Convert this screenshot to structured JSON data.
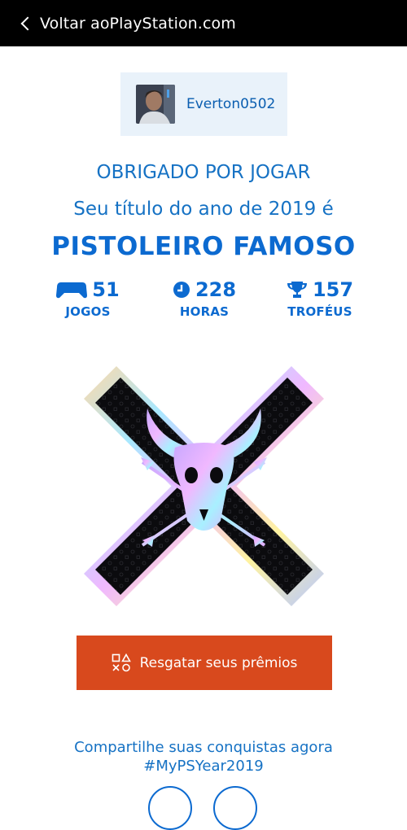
{
  "header": {
    "back_label": "Voltar aoPlayStation.com"
  },
  "user": {
    "username": "Everton0502"
  },
  "texts": {
    "thanks": "OBRIGADO POR JOGAR",
    "subtitle": "Seu título do ano de 2019 é",
    "award_title": "PISTOLEIRO FAMOSO"
  },
  "stats": [
    {
      "value": "51",
      "label": "JOGOS",
      "icon": "gamepad-icon"
    },
    {
      "value": "228",
      "label": "HORAS",
      "icon": "clock-icon"
    },
    {
      "value": "157",
      "label": "TROFÉUS",
      "icon": "trophy-icon"
    }
  ],
  "actions": {
    "redeem_label": "Resgatar seus prêmios"
  },
  "share": {
    "line1": "Compartilhe suas conquistas agora",
    "line2": "#MyPSYear2019"
  },
  "colors": {
    "brand_blue": "#0c6ad0",
    "redeem_orange": "#d8491d",
    "chip_bg": "#e9f2fa"
  }
}
